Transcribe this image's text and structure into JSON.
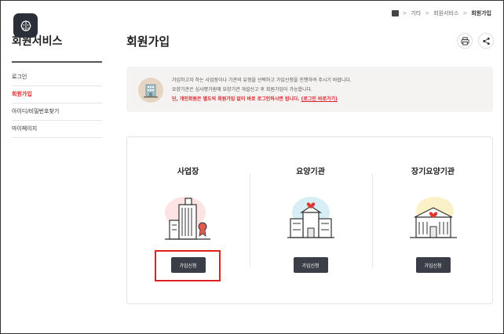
{
  "breadcrumb": {
    "items": [
      "기타",
      "회원서비스",
      "회원가입"
    ]
  },
  "sidebar": {
    "title": "회원서비스",
    "items": [
      {
        "label": "로그인"
      },
      {
        "label": "회원가입"
      },
      {
        "label": "아이디/비밀번호찾기"
      },
      {
        "label": "마이페이지"
      }
    ]
  },
  "main": {
    "title": "회원가입",
    "info": {
      "line1": "가입하고자 하는 사업장이나 기관의 유형을 선택하고 가입신청을 진행하여 주시기 바랍니다.",
      "line2": "요양기관은 심사평가원에 요양기관 개설신고 후 회원가입이 가능합니다.",
      "line3_warn": "단, 개인회원은 별도의 회원가입 없이 바로 로그인하시면 됩니다.",
      "login_link": "(로그인 바로가기)"
    },
    "cards": [
      {
        "title": "사업장",
        "button": "가입신청"
      },
      {
        "title": "요양기관",
        "button": "가입신청"
      },
      {
        "title": "장기요양기관",
        "button": "가입신청"
      }
    ]
  },
  "colors": {
    "accent_red": "#e0201f",
    "button_dark": "#3a3e47"
  },
  "icons": [
    "home-icon",
    "brain-icon",
    "print-icon",
    "share-icon",
    "building-icon"
  ]
}
